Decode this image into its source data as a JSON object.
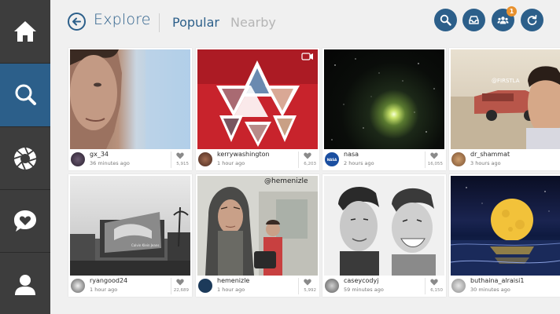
{
  "header": {
    "title": "Explore",
    "tabs": {
      "popular": "Popular",
      "nearby": "Nearby"
    },
    "notification_count": "1"
  },
  "sidebar": {
    "items": [
      "home-icon",
      "search-icon",
      "camera-aperture-icon",
      "heart-chat-icon",
      "profile-icon"
    ],
    "active": "search-icon"
  },
  "colors": {
    "accent": "#2c5f8a",
    "sidebar": "#3d3d3d",
    "badge": "#e8912e"
  },
  "cards": [
    {
      "user": "gx_34",
      "time": "36 minutes ago",
      "likes": "5,915"
    },
    {
      "user": "kerrywashington",
      "time": "1 hour ago",
      "likes": "6,203"
    },
    {
      "user": "nasa",
      "time": "2 hours ago",
      "likes": "16,055"
    },
    {
      "user": "dr_shammat",
      "time": "3 hours ago",
      "likes": ""
    },
    {
      "user": "ryangood24",
      "time": "1 hour ago",
      "likes": "22,689"
    },
    {
      "user": "hemenizle",
      "time": "1 hour ago",
      "likes": "5,992"
    },
    {
      "user": "caseycodyj",
      "time": "59 minutes ago",
      "likes": "6,150"
    },
    {
      "user": "buthaina_alraisi1",
      "time": "30 minutes ago",
      "likes": ""
    }
  ],
  "photo_text": {
    "card4_caption": "@FIRSTLA",
    "card5_billboard": "Calvin Klein Jeans",
    "card6_handle": "@hemenizle",
    "card8_caption": "",
    "nasa_avatar": "NASA"
  }
}
